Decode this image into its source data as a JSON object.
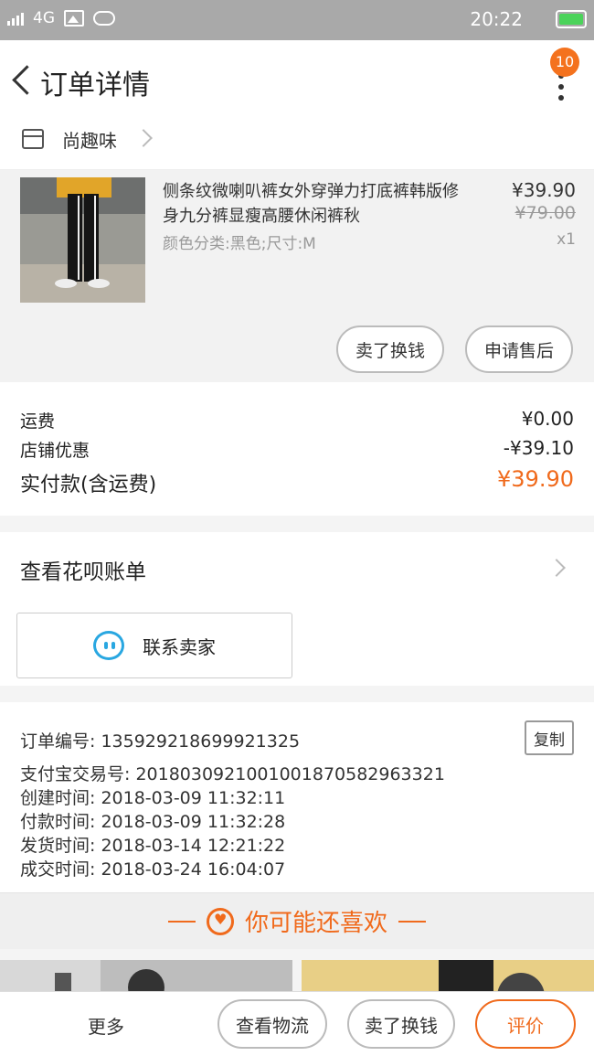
{
  "status_bar": {
    "network": "4G",
    "time": "20:22"
  },
  "header": {
    "title": "订单详情",
    "notification_count": "10"
  },
  "shop": {
    "name": "尚趣味"
  },
  "product": {
    "title": "侧条纹微喇叭裤女外穿弹力打底裤韩版修身九分裤显瘦高腰休闲裤秋",
    "sku": "颜色分类:黑色;尺寸:M",
    "price": "¥39.90",
    "original_price": "¥79.00",
    "quantity": "x1",
    "actions": {
      "sell_exchange": "卖了换钱",
      "after_sales": "申请售后"
    }
  },
  "fees": {
    "shipping_label": "运费",
    "shipping_value": "¥0.00",
    "discount_label": "店铺优惠",
    "discount_value": "-¥39.10",
    "total_label": "实付款(含运费)",
    "total_value": "¥39.90"
  },
  "huabei": {
    "label": "查看花呗账单"
  },
  "contact": {
    "label": "联系卖家"
  },
  "order_info": {
    "order_no": "订单编号: 135929218699921325",
    "alipay_no": "支付宝交易号: 2018030921001001870582963321",
    "created": "创建时间: 2018-03-09 11:32:11",
    "paid": "付款时间: 2018-03-09 11:32:28",
    "shipped": "发货时间: 2018-03-14 12:21:22",
    "completed": "成交时间: 2018-03-24 16:04:07",
    "copy_label": "复制"
  },
  "recommend": {
    "title": "你可能还喜欢"
  },
  "bottom_bar": {
    "more": "更多",
    "logistics": "查看物流",
    "sell_exchange": "卖了换钱",
    "review": "评价"
  },
  "colors": {
    "accent": "#f06a1c",
    "badge": "#f4721e",
    "chat_icon": "#29a7e1"
  }
}
